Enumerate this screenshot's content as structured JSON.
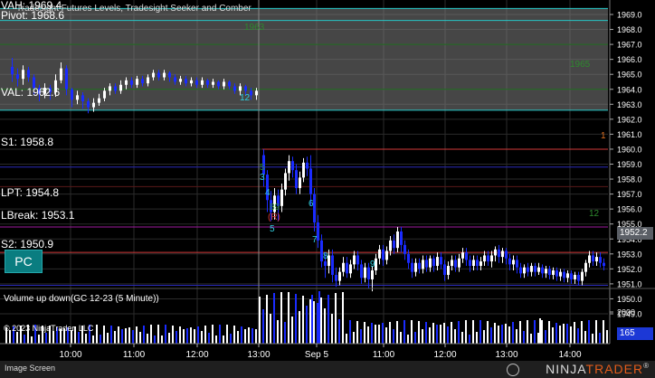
{
  "chart": {
    "title": "Tradesight Futures Levels, Tradesight Seeker and Comber",
    "price_axis_ticks": [
      "1969.0",
      "1968.0",
      "1967.0",
      "1966.0",
      "1965.0",
      "1964.0",
      "1963.0",
      "1962.0",
      "1961.0",
      "1960.0",
      "1959.0",
      "1958.0",
      "1957.0",
      "1956.0",
      "1955.0",
      "1954.0",
      "1953.0",
      "1952.0",
      "1951.0",
      "1950.0",
      "1949.0"
    ],
    "last_price": "1952.2",
    "time_axis_ticks": [
      "10:00",
      "11:00",
      "12:00",
      "13:00",
      "Sep 5",
      "11:00",
      "12:00",
      "13:00",
      "14:00"
    ],
    "levels": {
      "vah": "VAH: 1969.4",
      "pivot": "Pivot: 1968.6",
      "val": "VAL: 1962.6",
      "s1": "S1: 1958.8",
      "lpt": "LPT: 1954.8",
      "lbreak": "LBreak: 1953.1",
      "s2": "S2: 1950.9"
    },
    "pc_label": "PC",
    "colors": {
      "up_candle": "#ffffff",
      "down_candle": "#1a2bff",
      "value_area": "#808080",
      "cyan_line": "#27c6c6",
      "blue_line": "#2a2ab8",
      "magenta_line": "#a01aa0",
      "red_line": "#d43a3a",
      "grid": "#2b2b2b"
    }
  },
  "annotations": {
    "upper": [
      {
        "text": "1963",
        "color": "#2e8a2e"
      },
      {
        "text": "12",
        "color": "#2fd0e0"
      },
      {
        "text": "1965",
        "color": "#2e8a2e"
      }
    ],
    "lower": [
      {
        "text": "1",
        "color": "#e07020"
      },
      {
        "text": "5",
        "color": "#2e8a2e"
      },
      {
        "text": "3",
        "color": "#2fd0e0"
      },
      {
        "text": "4",
        "color": "#2fd0e0"
      },
      {
        "text": "89",
        "color": "#2e8a2e"
      },
      {
        "text": "6",
        "color": "#2fd0e0"
      },
      {
        "text": "(R)",
        "color": "#d43a3a"
      },
      {
        "text": "5",
        "color": "#2fd0e0"
      },
      {
        "text": "7",
        "color": "#2fd0e0"
      },
      {
        "text": "8",
        "color": "#2fd0e0"
      },
      {
        "text": "9",
        "color": "#2fd0e0"
      },
      {
        "text": "12",
        "color": "#2e8a2e"
      }
    ]
  },
  "volume": {
    "title": "Volume up down(GC 12-23 (5 Minute))",
    "axis_tick": "2000",
    "last_volume": "165",
    "copyright": "© 2023 NinjaTrader, LLC"
  },
  "footer": {
    "mode_label": "Image Screen",
    "brand_prefix": "NINJA",
    "brand_suffix": "TRADER",
    "trademark": "®"
  }
}
